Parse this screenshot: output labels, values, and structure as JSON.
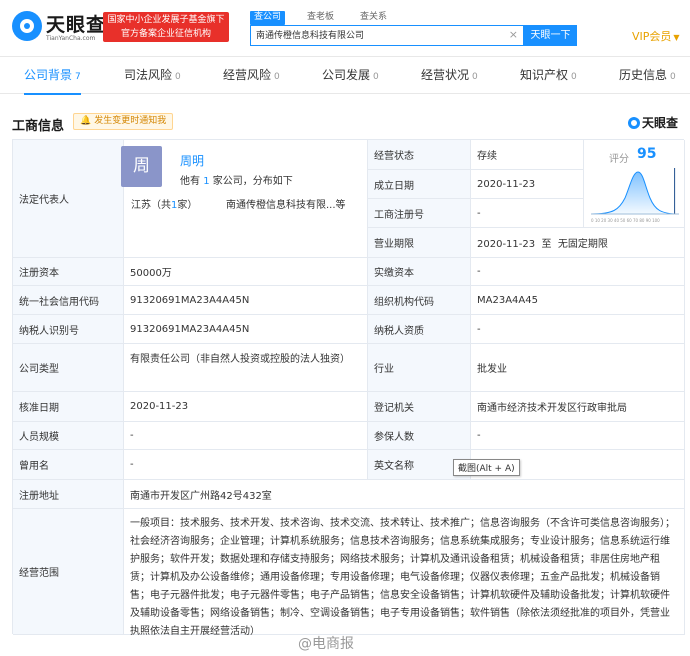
{
  "header": {
    "logo_text": "天眼查",
    "logo_sub": "TianYanCha.com",
    "banner_line1": "国家中小企业发展子基金旗下",
    "banner_line2": "官方备案企业征信机构",
    "search_tabs": [
      "查公司",
      "查老板",
      "查关系"
    ],
    "search_value": "南通传橙信息科技有限公司",
    "search_button": "天眼一下",
    "vip_label": "VIP会员"
  },
  "nav": [
    {
      "label": "公司背景",
      "count": "7"
    },
    {
      "label": "司法风险",
      "count": "0"
    },
    {
      "label": "经营风险",
      "count": "0"
    },
    {
      "label": "公司发展",
      "count": "0"
    },
    {
      "label": "经营状况",
      "count": "0"
    },
    {
      "label": "知识产权",
      "count": "0"
    },
    {
      "label": "历史信息",
      "count": "0"
    }
  ],
  "section": {
    "title": "工商信息",
    "notify": "发生变更时通知我",
    "watermark_brand": "天眼查"
  },
  "representative": {
    "label": "法定代表人",
    "avatar_char": "周",
    "name": "周明",
    "desc_pre": "他有",
    "desc_num": "1",
    "desc_post": "家公司，分布如下",
    "region_pre": "江苏（共",
    "region_num": "1",
    "region_post": "家）",
    "company": "南通传橙信息科技有限...等"
  },
  "score": {
    "label": "评分",
    "value": "95",
    "axis": "0 10 20 30 40 50 60 70 80 90 100",
    "value_num": 95
  },
  "rows": {
    "status_label": "经营状态",
    "status_value": "存续",
    "est_label": "成立日期",
    "est_value": "2020-11-23",
    "reg_no_label": "工商注册号",
    "reg_no_value": "-",
    "term_label": "营业期限",
    "term_value": "2020-11-23  至  无固定期限",
    "capital_label": "注册资本",
    "capital_value": "50000万",
    "paid_label": "实缴资本",
    "paid_value": "-",
    "credit_label": "统一社会信用代码",
    "credit_value": "91320691MA23A4A45N",
    "org_label": "组织机构代码",
    "org_value": "MA23A4A45",
    "tax_label": "纳税人识别号",
    "tax_value": "91320691MA23A4A45N",
    "taxq_label": "纳税人资质",
    "taxq_value": "-",
    "type_label": "公司类型",
    "type_value": "有限责任公司（非自然人投资或控股的法人独资）",
    "industry_label": "行业",
    "industry_value": "批发业",
    "approve_label": "核准日期",
    "approve_value": "2020-11-23",
    "authority_label": "登记机关",
    "authority_value": "南通市经济技术开发区行政审批局",
    "staff_label": "人员规模",
    "staff_value": "-",
    "insured_label": "参保人数",
    "insured_value": "-",
    "former_label": "曾用名",
    "former_value": "-",
    "english_label": "英文名称",
    "english_value": "",
    "address_label": "注册地址",
    "address_value": "南通市开发区广州路42号432室",
    "scope_label": "经营范围",
    "scope_value": "一般项目：技术服务、技术开发、技术咨询、技术交流、技术转让、技术推广；信息咨询服务（不含许可类信息咨询服务）；社会经济咨询服务；企业管理；计算机系统服务；信息技术咨询服务；信息系统集成服务；专业设计服务；信息系统运行维护服务；软件开发；数据处理和存储支持服务；网络技术服务；计算机及通讯设备租赁；机械设备租赁；非居住房地产租赁；计算机及办公设备维修；通用设备修理；专用设备修理；电气设备修理；仪器仪表修理；五金产品批发；机械设备销售；电子元器件批发；电子元器件零售；电子产品销售；信息安全设备销售；计算机软硬件及辅助设备批发；计算机软硬件及辅助设备零售；网络设备销售；制冷、空调设备销售；电子专用设备销售；软件销售（除依法须经批准的项目外，凭营业执照依法自主开展经营活动）"
  },
  "tooltip": "截图(Alt + A)",
  "watermark": "@电商报",
  "colors": {
    "accent": "#1890ff",
    "banner": "#e8302a",
    "vip": "#e8a200",
    "label_bg": "#f4f8fd"
  }
}
